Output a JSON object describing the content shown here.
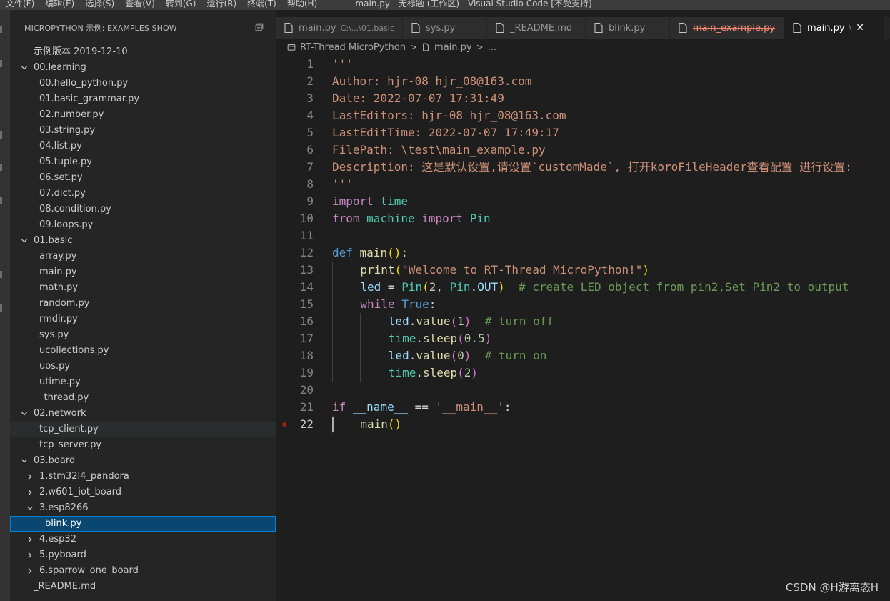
{
  "window": {
    "title": "main.py - 无标题 (工作区) - Visual Studio Code [不受支持]",
    "menu": [
      "文件(F)",
      "编辑(E)",
      "选择(S)",
      "查看(V)",
      "转到(G)",
      "运行(R)",
      "终端(T)",
      "帮助(H)"
    ]
  },
  "sidebar": {
    "title": "MICROPYTHON 示例: EXAMPLES SHOW",
    "tree": [
      {
        "label": "示例版本 2019-12-10",
        "depth": 0,
        "folder": false
      },
      {
        "label": "00.learning",
        "depth": 0,
        "folder": true,
        "expanded": true
      },
      {
        "label": "00.hello_python.py",
        "depth": 1,
        "folder": false
      },
      {
        "label": "01.basic_grammar.py",
        "depth": 1,
        "folder": false
      },
      {
        "label": "02.number.py",
        "depth": 1,
        "folder": false
      },
      {
        "label": "03.string.py",
        "depth": 1,
        "folder": false
      },
      {
        "label": "04.list.py",
        "depth": 1,
        "folder": false
      },
      {
        "label": "05.tuple.py",
        "depth": 1,
        "folder": false
      },
      {
        "label": "06.set.py",
        "depth": 1,
        "folder": false
      },
      {
        "label": "07.dict.py",
        "depth": 1,
        "folder": false
      },
      {
        "label": "08.condition.py",
        "depth": 1,
        "folder": false
      },
      {
        "label": "09.loops.py",
        "depth": 1,
        "folder": false
      },
      {
        "label": "01.basic",
        "depth": 0,
        "folder": true,
        "expanded": true
      },
      {
        "label": "array.py",
        "depth": 1,
        "folder": false
      },
      {
        "label": "main.py",
        "depth": 1,
        "folder": false
      },
      {
        "label": "math.py",
        "depth": 1,
        "folder": false
      },
      {
        "label": "random.py",
        "depth": 1,
        "folder": false
      },
      {
        "label": "rmdir.py",
        "depth": 1,
        "folder": false
      },
      {
        "label": "sys.py",
        "depth": 1,
        "folder": false
      },
      {
        "label": "ucollections.py",
        "depth": 1,
        "folder": false
      },
      {
        "label": "uos.py",
        "depth": 1,
        "folder": false
      },
      {
        "label": "utime.py",
        "depth": 1,
        "folder": false
      },
      {
        "label": "_thread.py",
        "depth": 1,
        "folder": false
      },
      {
        "label": "02.network",
        "depth": 0,
        "folder": true,
        "expanded": true
      },
      {
        "label": "tcp_client.py",
        "depth": 1,
        "folder": false,
        "state": "hover"
      },
      {
        "label": "tcp_server.py",
        "depth": 1,
        "folder": false
      },
      {
        "label": "03.board",
        "depth": 0,
        "folder": true,
        "expanded": true
      },
      {
        "label": "1.stm32l4_pandora",
        "depth": 1,
        "folder": true,
        "expanded": false
      },
      {
        "label": "2.w601_iot_board",
        "depth": 1,
        "folder": true,
        "expanded": false
      },
      {
        "label": "3.esp8266",
        "depth": 1,
        "folder": true,
        "expanded": true
      },
      {
        "label": "blink.py",
        "depth": 2,
        "folder": false,
        "state": "selected"
      },
      {
        "label": "4.esp32",
        "depth": 1,
        "folder": true,
        "expanded": false
      },
      {
        "label": "5.pyboard",
        "depth": 1,
        "folder": true,
        "expanded": false
      },
      {
        "label": "6.sparrow_one_board",
        "depth": 1,
        "folder": true,
        "expanded": false
      },
      {
        "label": "_README.md",
        "depth": 0,
        "folder": false
      }
    ]
  },
  "tabs": [
    {
      "label": "main.py",
      "description": "C:\\...\\01.basic",
      "active": false,
      "deleted": false
    },
    {
      "label": "sys.py",
      "description": "",
      "active": false,
      "deleted": false
    },
    {
      "label": "_README.md",
      "description": "",
      "active": false,
      "deleted": false
    },
    {
      "label": "blink.py",
      "description": "",
      "active": false,
      "deleted": false
    },
    {
      "label": "main_example.py",
      "description": "",
      "active": false,
      "deleted": true
    },
    {
      "label": "main.py",
      "description": "\\",
      "active": true,
      "deleted": false,
      "close_glyph": "✕"
    }
  ],
  "breadcrumb": {
    "folder": "RT-Thread MicroPython",
    "file": "main.py",
    "more": "...",
    "separator": ">"
  },
  "editor": {
    "current_line": 22,
    "breakpoint_line": 22,
    "lines": [
      {
        "n": "1",
        "indent": 0,
        "tokens": [
          [
            "'''",
            "str"
          ]
        ]
      },
      {
        "n": "2",
        "indent": 0,
        "tokens": [
          [
            "Author: hjr-08 hjr_08@163.com",
            "str"
          ]
        ]
      },
      {
        "n": "3",
        "indent": 0,
        "tokens": [
          [
            "Date: 2022-07-07 17:31:49",
            "str"
          ]
        ]
      },
      {
        "n": "4",
        "indent": 0,
        "tokens": [
          [
            "LastEditors: hjr-08 hjr_08@163.com",
            "str"
          ]
        ]
      },
      {
        "n": "5",
        "indent": 0,
        "tokens": [
          [
            "LastEditTime: 2022-07-07 17:49:17",
            "str"
          ]
        ]
      },
      {
        "n": "6",
        "indent": 0,
        "tokens": [
          [
            "FilePath: \\test\\main_example.py",
            "str"
          ]
        ]
      },
      {
        "n": "7",
        "indent": 0,
        "tokens": [
          [
            "Description: 这是默认设置,请设置`customMade`, 打开koroFileHeader查看配置 进行设置:",
            "str"
          ]
        ]
      },
      {
        "n": "8",
        "indent": 0,
        "tokens": [
          [
            "'''",
            "str"
          ]
        ]
      },
      {
        "n": "9",
        "indent": 0,
        "tokens": [
          [
            "import",
            "kw"
          ],
          [
            " ",
            "pun"
          ],
          [
            "time",
            "cls"
          ]
        ]
      },
      {
        "n": "10",
        "indent": 0,
        "tokens": [
          [
            "from",
            "kw"
          ],
          [
            " ",
            "pun"
          ],
          [
            "machine",
            "cls"
          ],
          [
            " ",
            "pun"
          ],
          [
            "import",
            "kw"
          ],
          [
            " ",
            "pun"
          ],
          [
            "Pin",
            "cls"
          ]
        ]
      },
      {
        "n": "11",
        "indent": 0,
        "tokens": []
      },
      {
        "n": "12",
        "indent": 0,
        "tokens": [
          [
            "def",
            "kwb"
          ],
          [
            " ",
            "pun"
          ],
          [
            "main",
            "fn"
          ],
          [
            "()",
            "br"
          ],
          [
            ":",
            "pun"
          ]
        ]
      },
      {
        "n": "13",
        "indent": 1,
        "tokens": [
          [
            "print",
            "fn"
          ],
          [
            "(",
            "br"
          ],
          [
            "\"Welcome to RT-Thread MicroPython!\"",
            "str"
          ],
          [
            ")",
            "br"
          ]
        ]
      },
      {
        "n": "14",
        "indent": 1,
        "tokens": [
          [
            "led",
            "var"
          ],
          [
            " = ",
            "pun"
          ],
          [
            "Pin",
            "cls"
          ],
          [
            "(",
            "br"
          ],
          [
            "2",
            "num"
          ],
          [
            ", ",
            "pun"
          ],
          [
            "Pin",
            "cls"
          ],
          [
            ".",
            "pun"
          ],
          [
            "OUT",
            "var"
          ],
          [
            ")",
            "br"
          ],
          [
            "  # create LED object from pin2,Set Pin2 to output",
            "cmt"
          ]
        ]
      },
      {
        "n": "15",
        "indent": 1,
        "tokens": [
          [
            "while",
            "kw"
          ],
          [
            " ",
            "pun"
          ],
          [
            "True",
            "kwb"
          ],
          [
            ":",
            "pun"
          ]
        ]
      },
      {
        "n": "16",
        "indent": 2,
        "tokens": [
          [
            "led",
            "var"
          ],
          [
            ".",
            "pun"
          ],
          [
            "value",
            "fn"
          ],
          [
            "(",
            "br2"
          ],
          [
            "1",
            "num"
          ],
          [
            ")",
            "br2"
          ],
          [
            "  # turn off",
            "cmt"
          ]
        ]
      },
      {
        "n": "17",
        "indent": 2,
        "tokens": [
          [
            "time",
            "cls"
          ],
          [
            ".",
            "pun"
          ],
          [
            "sleep",
            "fn"
          ],
          [
            "(",
            "br2"
          ],
          [
            "0.5",
            "num"
          ],
          [
            ")",
            "br2"
          ]
        ]
      },
      {
        "n": "18",
        "indent": 2,
        "tokens": [
          [
            "led",
            "var"
          ],
          [
            ".",
            "pun"
          ],
          [
            "value",
            "fn"
          ],
          [
            "(",
            "br2"
          ],
          [
            "0",
            "num"
          ],
          [
            ")",
            "br2"
          ],
          [
            "  # turn on",
            "cmt"
          ]
        ]
      },
      {
        "n": "19",
        "indent": 2,
        "tokens": [
          [
            "time",
            "cls"
          ],
          [
            ".",
            "pun"
          ],
          [
            "sleep",
            "fn"
          ],
          [
            "(",
            "br2"
          ],
          [
            "2",
            "num"
          ],
          [
            ")",
            "br2"
          ]
        ]
      },
      {
        "n": "20",
        "indent": 0,
        "tokens": []
      },
      {
        "n": "21",
        "indent": 0,
        "tokens": [
          [
            "if",
            "kw"
          ],
          [
            " ",
            "pun"
          ],
          [
            "__name__",
            "var"
          ],
          [
            " == ",
            "pun"
          ],
          [
            "'__main__'",
            "str"
          ],
          [
            ":",
            "pun"
          ]
        ]
      },
      {
        "n": "22",
        "indent": 1,
        "tokens": [
          [
            "main",
            "fn"
          ],
          [
            "()",
            "br"
          ]
        ]
      }
    ]
  },
  "watermark": "CSDN @H游离态H",
  "colors": {
    "editor_bg": "#1e1e1e",
    "sidebar_bg": "#252526",
    "selection": "#094771",
    "string": "#ce9178",
    "keyword": "#c586c0",
    "comment": "#6a9955"
  }
}
